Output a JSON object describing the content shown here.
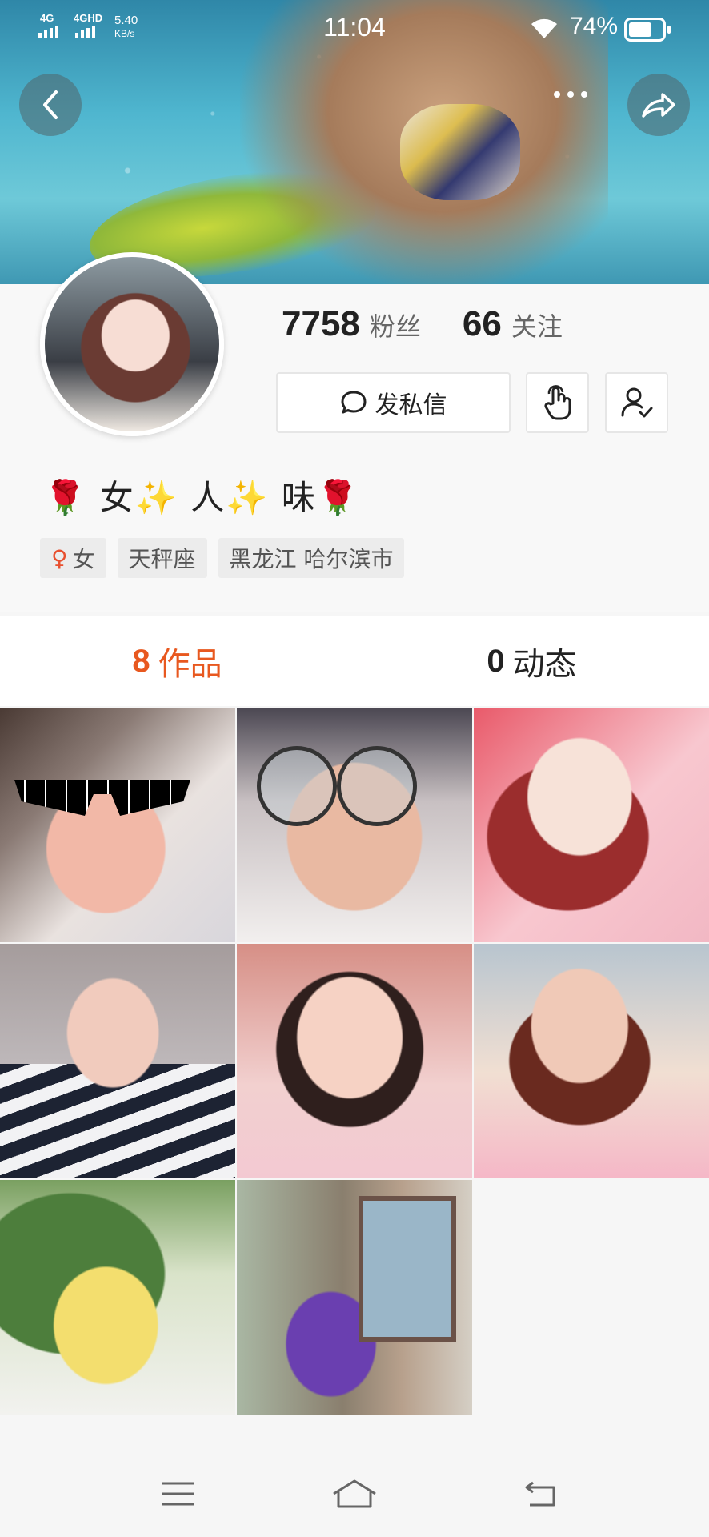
{
  "status_bar": {
    "network_1": "4G",
    "network_2": "4GHD",
    "speed_value": "5.40",
    "speed_unit": "KB/s",
    "time": "11:04",
    "battery": "74%"
  },
  "profile": {
    "followers_count": "7758",
    "followers_label": "粉丝",
    "following_count": "66",
    "following_label": "关注",
    "message_button": "发私信",
    "nickname": "🌹 女✨ 人✨ 味🌹",
    "tags": [
      "女",
      "天秤座",
      "黑龙江 哈尔滨市"
    ]
  },
  "tabs": [
    {
      "count": "8",
      "label": "作品",
      "active": true
    },
    {
      "count": "0",
      "label": "动态",
      "active": false
    }
  ],
  "icons": {
    "back": "chevron-left-icon",
    "more": "more-dots-icon",
    "share": "share-arrow-icon",
    "message": "chat-bubble-icon",
    "poke": "hand-tap-icon",
    "follow": "user-check-icon"
  },
  "colors": {
    "accent": "#e8581f",
    "female": "#e8502f"
  }
}
